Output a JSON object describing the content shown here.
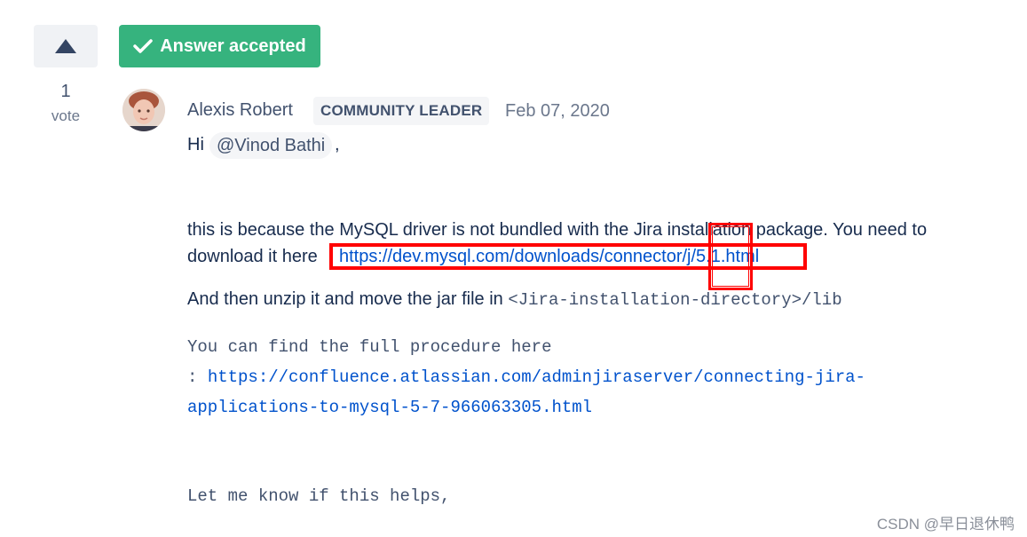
{
  "vote": {
    "count": "1",
    "label": "vote",
    "upvote_icon": "triangle-up-icon"
  },
  "accepted": {
    "label": "Answer accepted",
    "icon": "checkmark-icon",
    "color": "#36b37e"
  },
  "post": {
    "author": "Alexis Robert",
    "badge": "COMMUNITY LEADER",
    "date": "Feb 07, 2020",
    "greeting": "Hi",
    "mention": "@Vinod Bathi",
    "greeting_suffix": ",",
    "para1_line1": "this is because the MySQL driver is not bundled with the Jira installation package. You need to",
    "para1_line2_prefix": "download it here",
    "mysql_link": "https://dev.mysql.com/downloads/connector/j/5.1.html",
    "para2_prefix": "And then unzip it and move the jar file in",
    "para2_code": "<Jira-installation-directory>/lib",
    "procedure_line1": "You can find the full procedure here",
    "procedure_colon": ": ",
    "procedure_link_part1": "https://confluence.atlassian.com/adminjiraserver/connecting-jira-",
    "procedure_link_part2": "applications-to-mysql-5-7-966063305.html",
    "closing": "Let me know if this helps,"
  },
  "watermark": "CSDN @早日退休鸭",
  "colors": {
    "link": "#0052cc",
    "highlight": "#ff0000"
  }
}
